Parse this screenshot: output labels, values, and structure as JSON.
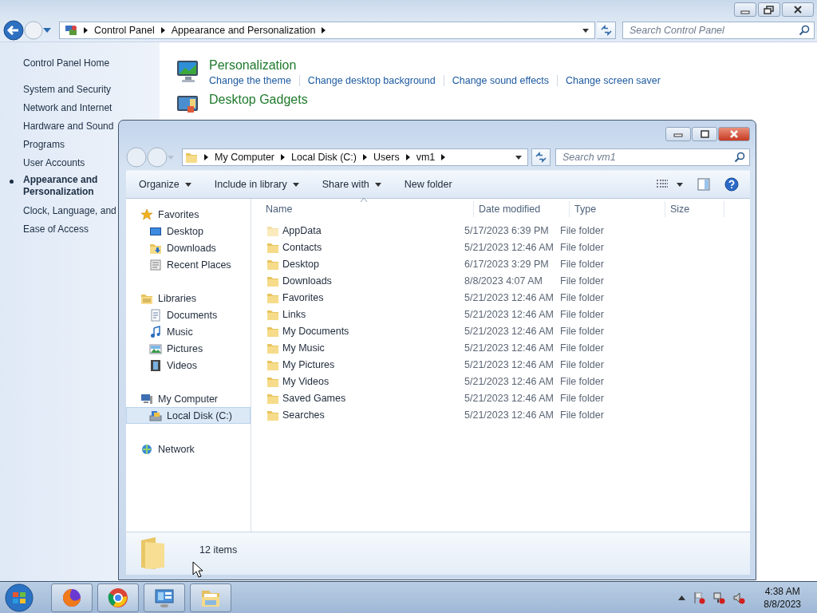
{
  "control_panel": {
    "address": {
      "segments": [
        "Control Panel",
        "Appearance and Personalization"
      ]
    },
    "search": {
      "placeholder": "Search Control Panel"
    },
    "home_link": "Control Panel Home",
    "categories": [
      {
        "label": "System and Security",
        "selected": false
      },
      {
        "label": "Network and Internet",
        "selected": false
      },
      {
        "label": "Hardware and Sound",
        "selected": false
      },
      {
        "label": "Programs",
        "selected": false
      },
      {
        "label": "User Accounts",
        "selected": false
      },
      {
        "label": "Appearance and Personalization",
        "selected": true
      },
      {
        "label": "Clock, Language, and",
        "selected": false
      },
      {
        "label": "Ease of Access",
        "selected": false
      }
    ],
    "sections": [
      {
        "title": "Personalization",
        "kind": "monitor",
        "links": [
          "Change the theme",
          "Change desktop background",
          "Change sound effects",
          "Change screen saver"
        ]
      },
      {
        "title": "Desktop Gadgets",
        "kind": "gadgets"
      }
    ]
  },
  "explorer": {
    "address": {
      "segments": [
        "My Computer",
        "Local Disk (C:)",
        "Users",
        "vm1"
      ]
    },
    "search": {
      "placeholder": "Search vm1"
    },
    "toolbar": [
      {
        "label": "Organize",
        "dropdown": true
      },
      {
        "label": "Include in library",
        "dropdown": true
      },
      {
        "label": "Share with",
        "dropdown": true
      },
      {
        "label": "New folder",
        "dropdown": false
      }
    ],
    "nav": [
      {
        "label": "Favorites",
        "kind": "star",
        "selected": false,
        "children": [
          {
            "label": "Desktop",
            "kind": "desktop",
            "selected": false
          },
          {
            "label": "Downloads",
            "kind": "downloads",
            "selected": false
          },
          {
            "label": "Recent Places",
            "kind": "recent",
            "selected": false
          }
        ]
      },
      {
        "label": "Libraries",
        "kind": "library",
        "selected": false,
        "children": [
          {
            "label": "Documents",
            "kind": "documents",
            "selected": false
          },
          {
            "label": "Music",
            "kind": "music",
            "selected": false
          },
          {
            "label": "Pictures",
            "kind": "pictures",
            "selected": false
          },
          {
            "label": "Videos",
            "kind": "videos",
            "selected": false
          }
        ]
      },
      {
        "label": "My Computer",
        "kind": "computer",
        "selected": false,
        "children": [
          {
            "label": "Local Disk (C:)",
            "kind": "drive",
            "selected": true
          }
        ]
      },
      {
        "label": "Network",
        "kind": "network",
        "selected": false
      }
    ],
    "columns": [
      "Name",
      "Date modified",
      "Type",
      "Size"
    ],
    "rows": [
      {
        "name": "AppData",
        "kind": "hidden",
        "date": "5/17/2023 6:39 PM",
        "type": "File folder"
      },
      {
        "name": "Contacts",
        "kind": "folder",
        "date": "5/21/2023 12:46 AM",
        "type": "File folder"
      },
      {
        "name": "Desktop",
        "kind": "folder",
        "date": "6/17/2023 3:29 PM",
        "type": "File folder"
      },
      {
        "name": "Downloads",
        "kind": "folder",
        "date": "8/8/2023 4:07 AM",
        "type": "File folder"
      },
      {
        "name": "Favorites",
        "kind": "folder",
        "date": "5/21/2023 12:46 AM",
        "type": "File folder"
      },
      {
        "name": "Links",
        "kind": "folder",
        "date": "5/21/2023 12:46 AM",
        "type": "File folder"
      },
      {
        "name": "My Documents",
        "kind": "folder",
        "date": "5/21/2023 12:46 AM",
        "type": "File folder"
      },
      {
        "name": "My Music",
        "kind": "folder",
        "date": "5/21/2023 12:46 AM",
        "type": "File folder"
      },
      {
        "name": "My Pictures",
        "kind": "folder",
        "date": "5/21/2023 12:46 AM",
        "type": "File folder"
      },
      {
        "name": "My Videos",
        "kind": "folder",
        "date": "5/21/2023 12:46 AM",
        "type": "File folder"
      },
      {
        "name": "Saved Games",
        "kind": "folder",
        "date": "5/21/2023 12:46 AM",
        "type": "File folder"
      },
      {
        "name": "Searches",
        "kind": "folder",
        "date": "5/21/2023 12:46 AM",
        "type": "File folder"
      }
    ],
    "status": "12 items"
  },
  "taskbar": {
    "time": "4:38 AM",
    "date": "8/8/2023"
  }
}
